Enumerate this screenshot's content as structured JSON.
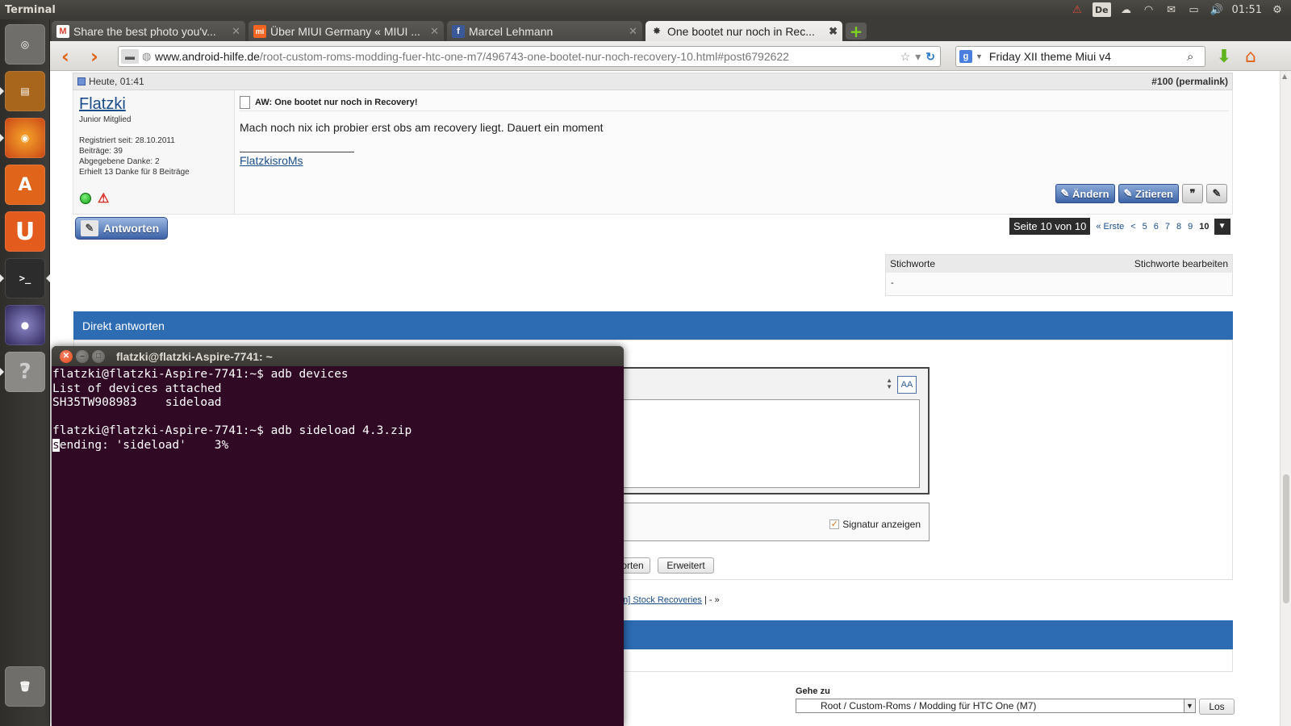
{
  "top_panel": {
    "app_title": "Terminal",
    "keyboard_layout": "De",
    "clock": "01:51"
  },
  "launcher": {
    "items": [
      {
        "name": "dash-home",
        "glyph": "◎",
        "color": "#6f6e6a"
      },
      {
        "name": "files",
        "glyph": "▤",
        "color": "#a8651c"
      },
      {
        "name": "firefox",
        "glyph": "◉",
        "color": "#d9561a"
      },
      {
        "name": "software-center",
        "glyph": "A",
        "color": "#e0651b"
      },
      {
        "name": "ubuntu-one",
        "glyph": "U",
        "color": "#e45b1e"
      },
      {
        "name": "terminal",
        "glyph": ">_",
        "color": "#2c2c2c"
      },
      {
        "name": "eclipse",
        "glyph": "●",
        "color": "#3a3269"
      },
      {
        "name": "help",
        "glyph": "?",
        "color": "#8a8985"
      },
      {
        "name": "trash",
        "glyph": "🗑",
        "color": "#6f6e6a"
      }
    ]
  },
  "browser": {
    "tabs": [
      {
        "label": "Share the best photo you'v...",
        "icon": "M",
        "icon_color": "#d94132"
      },
      {
        "label": "Über MIUI Germany « MIUI ...",
        "icon": "mi",
        "icon_color": "#f26522"
      },
      {
        "label": "Marcel Lehmann",
        "icon": "f",
        "icon_color": "#3b5998"
      },
      {
        "label": "One bootet nur noch in Rec...",
        "icon": "✸",
        "icon_color": "#333333"
      }
    ],
    "url_domain": "www.android-hilfe.de",
    "url_path": "/root-custom-roms-modding-fuer-htc-one-m7/496743-one-bootet-nur-noch-recovery-10.html#post6792622",
    "search_value": "Friday XII theme Miui v4"
  },
  "post": {
    "date": "Heute, 01:41",
    "number": "#100",
    "permalink": "permalink",
    "username": "Flatzki",
    "rank": "Junior Mitglied",
    "stats": [
      "Registriert seit: 28.10.2011",
      "Beiträge: 39",
      "Abgegebene Danke: 2",
      "Erhielt 13 Danke für 8 Beiträge"
    ],
    "title": "AW: One bootet nur noch in Recovery!",
    "text": "Mach noch nix ich probier erst obs am recovery liegt. Dauert ein moment",
    "signature": "FlatzkisroMs",
    "btn_edit": "Ändern",
    "btn_quote": "Zitieren"
  },
  "thread": {
    "reply_button": "Antworten",
    "page_info": "Seite 10 von 10",
    "first": "« Erste",
    "prev": "<",
    "pages": [
      "5",
      "6",
      "7",
      "8",
      "9",
      "10"
    ],
    "current_page": "10",
    "tags_header": "Stichworte",
    "tags_edit": "Stichworte bearbeiten",
    "tags_value": "-",
    "quick_reply_title": "Direkt antworten",
    "sig_option": "Signatur anzeigen",
    "btn_reply_partial": "orten",
    "btn_advanced": "Erweitert",
    "similar_link": "on] Stock Recoveries",
    "similar_tail": " | - »",
    "goto_label": "Gehe zu",
    "goto_value": "Root / Custom-Roms / Modding für HTC One (M7)",
    "goto_button": "Los"
  },
  "terminal": {
    "title": "flatzki@flatzki-Aspire-7741: ~",
    "lines": [
      "flatzki@flatzki-Aspire-7741:~$ adb devices",
      "List of devices attached",
      "SH35TW908983\tsideload",
      "",
      "flatzki@flatzki-Aspire-7741:~$ adb sideload 4.3.zip"
    ],
    "last_line_cursor_char": "s",
    "last_line_rest": "ending: 'sideload'    3%"
  }
}
